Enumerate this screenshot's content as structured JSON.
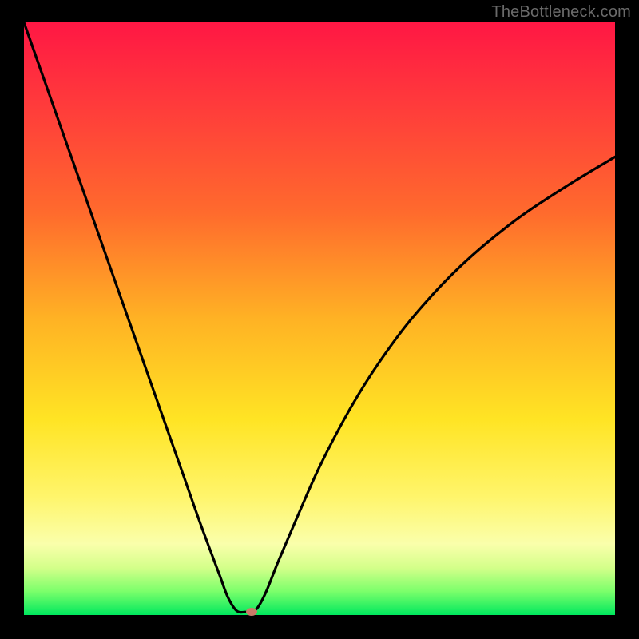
{
  "watermark": "TheBottleneck.com",
  "chart_data": {
    "type": "line",
    "title": "",
    "xlabel": "",
    "ylabel": "",
    "xlim": [
      0,
      100
    ],
    "ylim": [
      0,
      100
    ],
    "grid": false,
    "series": [
      {
        "name": "bottleneck-curve",
        "x": [
          0,
          3,
          6,
          9,
          12,
          15,
          18,
          21,
          24,
          27,
          30,
          33,
          34.5,
          36,
          37.5,
          38.5,
          39.5,
          41,
          43,
          46,
          50,
          55,
          60,
          66,
          74,
          83,
          92,
          100
        ],
        "y": [
          100,
          91.5,
          83,
          74.5,
          66,
          57.5,
          49,
          40.5,
          32,
          23.5,
          15,
          7,
          3,
          0.7,
          0.5,
          0.6,
          1.2,
          4,
          9,
          16,
          25,
          34.5,
          42.5,
          50.5,
          59,
          66.5,
          72.5,
          77.3
        ]
      }
    ],
    "marker": {
      "x": 38.5,
      "y": 0.6
    },
    "gradient_stops": [
      {
        "pct": 0,
        "color": "#ff1744"
      },
      {
        "pct": 14,
        "color": "#ff3b3b"
      },
      {
        "pct": 32,
        "color": "#ff6a2d"
      },
      {
        "pct": 50,
        "color": "#ffb224"
      },
      {
        "pct": 67,
        "color": "#ffe424"
      },
      {
        "pct": 80,
        "color": "#fff56b"
      },
      {
        "pct": 88,
        "color": "#faffab"
      },
      {
        "pct": 92,
        "color": "#d4ff8a"
      },
      {
        "pct": 96,
        "color": "#7cff6b"
      },
      {
        "pct": 100,
        "color": "#00e85e"
      }
    ]
  }
}
